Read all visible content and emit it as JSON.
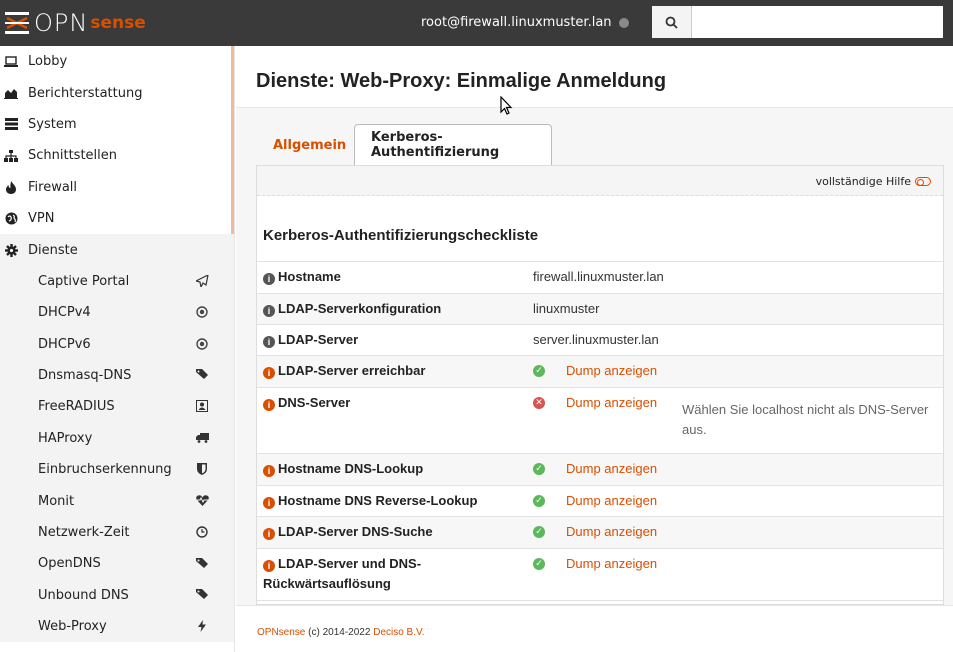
{
  "topbar": {
    "logo_text": "OPN",
    "logo_sense": "sense",
    "user": "root@firewall.linuxmuster.lan",
    "search_placeholder": ""
  },
  "sidebar": {
    "items": [
      {
        "label": "Lobby",
        "icon": "laptop-icon"
      },
      {
        "label": "Berichterstattung",
        "icon": "area-chart-icon"
      },
      {
        "label": "System",
        "icon": "server-icon"
      },
      {
        "label": "Schnittstellen",
        "icon": "sitemap-icon"
      },
      {
        "label": "Firewall",
        "icon": "fire-icon"
      },
      {
        "label": "VPN",
        "icon": "globe-icon"
      },
      {
        "label": "Dienste",
        "icon": "cog-icon"
      }
    ],
    "subitems": [
      {
        "label": "Captive Portal",
        "icon": "paper-plane-icon"
      },
      {
        "label": "DHCPv4",
        "icon": "bullseye-icon"
      },
      {
        "label": "DHCPv6",
        "icon": "bullseye-icon"
      },
      {
        "label": "Dnsmasq-DNS",
        "icon": "tags-icon"
      },
      {
        "label": "FreeRADIUS",
        "icon": "id-card-icon"
      },
      {
        "label": "HAProxy",
        "icon": "truck-icon"
      },
      {
        "label": "Einbruchserkennung",
        "icon": "shield-icon"
      },
      {
        "label": "Monit",
        "icon": "heartbeat-icon"
      },
      {
        "label": "Netzwerk-Zeit",
        "icon": "clock-icon"
      },
      {
        "label": "OpenDNS",
        "icon": "tags-icon"
      },
      {
        "label": "Unbound DNS",
        "icon": "tags-icon"
      },
      {
        "label": "Web-Proxy",
        "icon": "bolt-icon"
      }
    ]
  },
  "main": {
    "title": "Dienste: Web-Proxy: Einmalige Anmeldung",
    "tabs": [
      {
        "label": "Allgemein"
      },
      {
        "label": "Kerberos-Authentifizierung"
      }
    ],
    "help_label": "vollständige Hilfe",
    "section_title": "Kerberos-Authentifizierungscheckliste",
    "rows": [
      {
        "name": "Hostname",
        "value": "firewall.linuxmuster.lan"
      },
      {
        "name": "LDAP-Serverkonfiguration",
        "value": "linuxmuster"
      },
      {
        "name": "LDAP-Server",
        "value": "server.linuxmuster.lan"
      }
    ],
    "checks": [
      {
        "name": "LDAP-Server erreichbar",
        "status": "ok",
        "dump": "Dump anzeigen",
        "note": ""
      },
      {
        "name": "DNS-Server",
        "status": "error",
        "dump": "Dump anzeigen",
        "note": "Wählen Sie localhost nicht als DNS-Server aus."
      },
      {
        "name": "Hostname DNS-Lookup",
        "status": "ok",
        "dump": "Dump anzeigen",
        "note": ""
      },
      {
        "name": "Hostname DNS Reverse-Lookup",
        "status": "ok",
        "dump": "Dump anzeigen",
        "note": ""
      },
      {
        "name": "LDAP-Server DNS-Suche",
        "status": "ok",
        "dump": "Dump anzeigen",
        "note": ""
      },
      {
        "name": "LDAP-Server und DNS-Rückwärtsauflösung",
        "status": "ok",
        "dump": "Dump anzeigen",
        "note": ""
      }
    ]
  },
  "footer": {
    "brand": "OPNsense",
    "copyright": " (c) 2014-2022 ",
    "company": "Deciso B.V."
  },
  "colors": {
    "accent": "#d94f00",
    "topbar": "#3a3a3a",
    "ok": "#5cb85c",
    "error": "#d9534f"
  }
}
